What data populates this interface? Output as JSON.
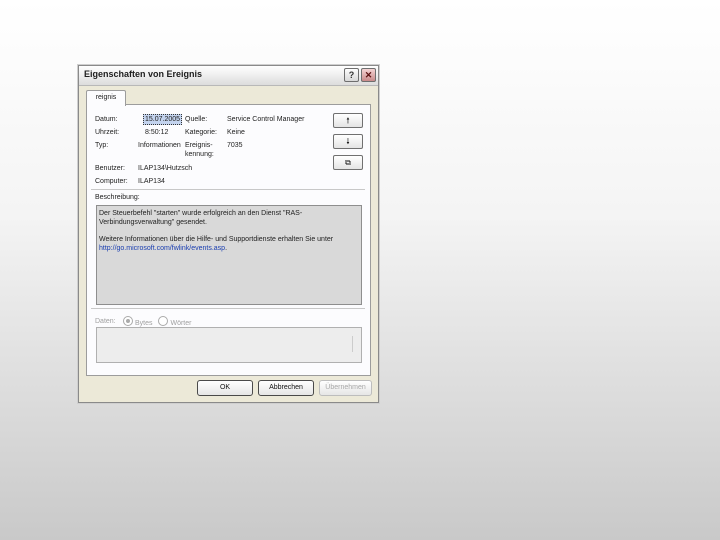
{
  "window": {
    "title": "Eigenschaften von Ereignis",
    "help_glyph": "?",
    "close_glyph": "✕"
  },
  "tab": {
    "label": "reignis"
  },
  "fields": {
    "datum_label": "Datum:",
    "datum_value": "15.07.2005",
    "uhrzeit_label": "Uhrzeit:",
    "uhrzeit_value": "8:50:12",
    "typ_label": "Typ:",
    "typ_value": "Informationen",
    "quelle_label": "Quelle:",
    "quelle_value": "Service Control Manager",
    "kategorie_label": "Kategorie:",
    "kategorie_value": "Keine",
    "ereignis_label_1": "Ereignis-",
    "ereignis_label_2": "kennung:",
    "ereignis_value": "7035",
    "benutzer_label": "Benutzer:",
    "benutzer_value": "ILAP134\\Hutzsch",
    "computer_label": "Computer:",
    "computer_value": "ILAP134"
  },
  "side_buttons": {
    "up": "🠕",
    "down": "🠗",
    "copy": "⧉"
  },
  "description": {
    "label": "Beschreibung:",
    "line1": "Der Steuerbefehl \"starten\" wurde erfolgreich an den Dienst \"RAS-Verbindungsverwaltung\" gesendet.",
    "line2_prefix": "Weitere Informationen über die Hilfe- und Supportdienste erhalten Sie unter ",
    "link": "http://go.microsoft.com/fwlink/events.asp",
    "line2_suffix": "."
  },
  "data": {
    "label": "Daten:",
    "option_bytes": "Bytes",
    "option_words": "Wörter"
  },
  "buttons": {
    "ok": "OK",
    "cancel": "Abbrechen",
    "apply": "Übernehmen"
  }
}
